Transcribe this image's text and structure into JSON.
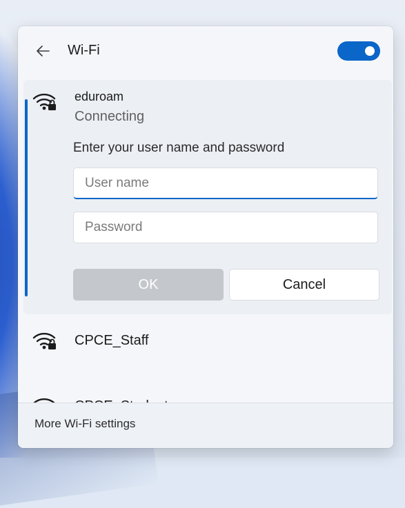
{
  "header": {
    "title": "Wi-Fi",
    "wifi_toggle_on": true,
    "accent_color": "#0a66c8"
  },
  "connecting_network": {
    "name": "eduroam",
    "status": "Connecting",
    "prompt": "Enter your user name and password",
    "username": {
      "value": "",
      "placeholder": "User name"
    },
    "password": {
      "value": "",
      "placeholder": "Password"
    },
    "ok_label": "OK",
    "cancel_label": "Cancel",
    "icon": "wifi-secured-icon"
  },
  "networks": [
    {
      "name": "CPCE_Staff",
      "icon": "wifi-secured-icon"
    },
    {
      "name": "CPCE_Student",
      "icon": "wifi-secured-icon"
    }
  ],
  "footer": {
    "settings_link": "More Wi-Fi settings"
  }
}
